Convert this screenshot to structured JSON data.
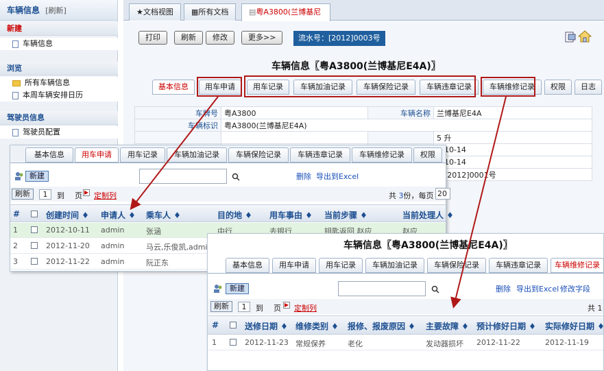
{
  "sidebar": {
    "title": "车辆信息",
    "refresh": "[刷新]",
    "sections": [
      {
        "heading": "新建",
        "items": [
          "车辆信息"
        ]
      },
      {
        "heading": "浏览",
        "items": [
          "所有车辆信息",
          "本周车辆安排日历"
        ]
      },
      {
        "heading": "驾驶员信息",
        "items": [
          "驾驶员配置"
        ]
      }
    ]
  },
  "top_tabs": [
    "文档视图",
    "所有文档",
    "粤A3800(兰博基尼E"
  ],
  "toolbar": {
    "print": "打印",
    "refresh": "刷新",
    "edit": "修改",
    "more": "更多>>",
    "flow_no": "流水号：[2012]0003号"
  },
  "main": {
    "title": "车辆信息〖粤A3800(兰博基尼E4A)〗",
    "tabs": [
      "基本信息",
      "用车申请",
      "用车记录",
      "车辆加油记录",
      "车辆保险记录",
      "车辆违章记录",
      "车辆维修记录",
      "权限",
      "日志"
    ],
    "form": {
      "plate_label": "车牌号",
      "plate_value": "粤A3800",
      "name_label": "车辆名称",
      "name_value": "兰博基尼E4A",
      "mark_label": "车辆标识",
      "mark_value": "粤A3800(兰博基尼E4A)",
      "r3_tail": "5 升",
      "r4_tail": "2-10-14",
      "r5_tail": "2-10-14",
      "r6_tail": "大[2012]0001号"
    }
  },
  "panel1": {
    "tabs": [
      "基本信息",
      "用车申请",
      "用车记录",
      "车辆加油记录",
      "车辆保险记录",
      "车辆违章记录",
      "车辆维修记录",
      "权限"
    ],
    "new": "新建",
    "delete": "删除",
    "export": "导出到Excel",
    "refresh": "刷新",
    "page": "1",
    "to": "到",
    "page_unit": "页",
    "custom_cols": "定制列",
    "total_prefix": "共",
    "total_count": "3",
    "total_unit": "份，每页",
    "per_page": "20",
    "headers": [
      "#",
      "创建时间 ♦",
      "申请人 ♦",
      "乘车人 ♦",
      "目的地 ♦",
      "用车事由 ♦",
      "当前步骤 ♦",
      "当前处理人 ♦"
    ],
    "rows": [
      [
        "1",
        "2012-10-11",
        "admin",
        "张涵",
        "中行",
        "去银行",
        "钥匙返回 赵应",
        "赵应"
      ],
      [
        "2",
        "2012-11-20",
        "admin",
        "马云,乐俊凯,admin",
        "",
        "",
        "",
        ""
      ],
      [
        "3",
        "2012-11-22",
        "admin",
        "阮正东",
        "",
        "",
        "",
        ""
      ]
    ]
  },
  "panel2": {
    "title": "车辆信息〖粤A3800(兰博基尼E4A)〗",
    "tabs": [
      "基本信息",
      "用车申请",
      "用车记录",
      "车辆加油记录",
      "车辆保险记录",
      "车辆违章记录",
      "车辆维修记录"
    ],
    "new": "新建",
    "delete": "删除",
    "export": "导出到Excel",
    "edit_fields": "修改字段",
    "refresh": "刷新",
    "page": "1",
    "to": "到",
    "page_unit": "页",
    "custom_cols": "定制列",
    "total_prefix": "共 1 -",
    "headers": [
      "#",
      "送修日期 ♦",
      "维修类别 ♦",
      "报修、报废原因 ♦",
      "主要故障 ♦",
      "预计修好日期 ♦",
      "实际修好日期 ♦"
    ],
    "rows": [
      [
        "1",
        "2012-11-23",
        "常规保养",
        "老化",
        "发动器损坏",
        "2012-11-22",
        "2012-11-19"
      ]
    ]
  },
  "colors": {
    "accent_red": "#b01818",
    "link_blue": "#1a4fb8",
    "flow_bg": "#1f5f9e"
  }
}
